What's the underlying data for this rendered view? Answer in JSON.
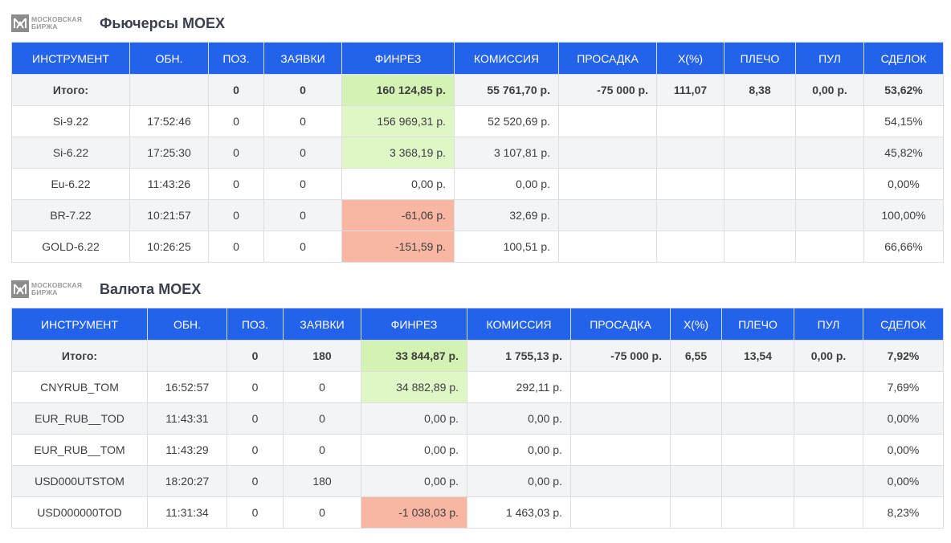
{
  "futures": {
    "logo_line1": "Московская",
    "logo_line2": "Биржа",
    "title": "Фьючерсы MOEX",
    "headers": [
      "ИНСТРУМЕНТ",
      "ОБН.",
      "ПОЗ.",
      "ЗАЯВКИ",
      "ФИНРЕЗ",
      "КОМИССИЯ",
      "ПРОСАДКА",
      "X(%)",
      "ПЛЕЧО",
      "ПУЛ",
      "СДЕЛОК"
    ],
    "total": {
      "instrument": "Итого:",
      "time": "",
      "pos": "0",
      "orders": "0",
      "finres": "160 124,85 р.",
      "commission": "55 761,70 р.",
      "drawdown": "-75 000 р.",
      "x": "111,07",
      "leverage": "8,38",
      "pool": "0,00 р.",
      "deals": "53,62%"
    },
    "rows": [
      {
        "instrument": "Si-9.22",
        "time": "17:52:46",
        "pos": "0",
        "orders": "0",
        "finres": "156 969,31 р.",
        "commission": "52 520,69 р.",
        "drawdown": "",
        "x": "",
        "leverage": "",
        "pool": "",
        "deals": "54,15%"
      },
      {
        "instrument": "Si-6.22",
        "time": "17:25:30",
        "pos": "0",
        "orders": "0",
        "finres": "3 368,19 р.",
        "commission": "3 107,81 р.",
        "drawdown": "",
        "x": "",
        "leverage": "",
        "pool": "",
        "deals": "45,82%"
      },
      {
        "instrument": "Eu-6.22",
        "time": "11:43:26",
        "pos": "0",
        "orders": "0",
        "finres": "0,00 р.",
        "commission": "0,00 р.",
        "drawdown": "",
        "x": "",
        "leverage": "",
        "pool": "",
        "deals": "0,00%"
      },
      {
        "instrument": "BR-7.22",
        "time": "10:21:57",
        "pos": "0",
        "orders": "0",
        "finres": "-61,06 р.",
        "commission": "32,69 р.",
        "drawdown": "",
        "x": "",
        "leverage": "",
        "pool": "",
        "deals": "100,00%"
      },
      {
        "instrument": "GOLD-6.22",
        "time": "10:26:25",
        "pos": "0",
        "orders": "0",
        "finres": "-151,59 р.",
        "commission": "100,51 р.",
        "drawdown": "",
        "x": "",
        "leverage": "",
        "pool": "",
        "deals": "66,66%"
      }
    ]
  },
  "currency": {
    "logo_line1": "Московская",
    "logo_line2": "Биржа",
    "title": "Валюта MOEX",
    "headers": [
      "ИНСТРУМЕНТ",
      "ОБН.",
      "ПОЗ.",
      "ЗАЯВКИ",
      "ФИНРЕЗ",
      "КОМИССИЯ",
      "ПРОСАДКА",
      "X(%)",
      "ПЛЕЧО",
      "ПУЛ",
      "СДЕЛОК"
    ],
    "total": {
      "instrument": "Итого:",
      "time": "",
      "pos": "0",
      "orders": "180",
      "finres": "33 844,87 р.",
      "commission": "1 755,13 р.",
      "drawdown": "-75 000 р.",
      "x": "6,55",
      "leverage": "13,54",
      "pool": "0,00 р.",
      "deals": "7,92%"
    },
    "rows": [
      {
        "instrument": "CNYRUB_TOM",
        "time": "16:52:57",
        "pos": "0",
        "orders": "0",
        "finres": "34 882,89 р.",
        "commission": "292,11 р.",
        "drawdown": "",
        "x": "",
        "leverage": "",
        "pool": "",
        "deals": "7,69%"
      },
      {
        "instrument": "EUR_RUB__TOD",
        "time": "11:43:31",
        "pos": "0",
        "orders": "0",
        "finres": "0,00 р.",
        "commission": "0,00 р.",
        "drawdown": "",
        "x": "",
        "leverage": "",
        "pool": "",
        "deals": "0,00%"
      },
      {
        "instrument": "EUR_RUB__TOM",
        "time": "11:43:29",
        "pos": "0",
        "orders": "0",
        "finres": "0,00 р.",
        "commission": "0,00 р.",
        "drawdown": "",
        "x": "",
        "leverage": "",
        "pool": "",
        "deals": "0,00%"
      },
      {
        "instrument": "USD000UTSTOM",
        "time": "18:20:27",
        "pos": "0",
        "orders": "180",
        "finres": "0,00 р.",
        "commission": "0,00 р.",
        "drawdown": "",
        "x": "",
        "leverage": "",
        "pool": "",
        "deals": "0,00%"
      },
      {
        "instrument": "USD000000TOD",
        "time": "11:31:34",
        "pos": "0",
        "orders": "0",
        "finres": "-1 038,03 р.",
        "commission": "1 463,03 р.",
        "drawdown": "",
        "x": "",
        "leverage": "",
        "pool": "",
        "deals": "8,23%"
      }
    ]
  },
  "colors": {
    "header_bg": "#2362ea",
    "profit_bg": "#dff7c6",
    "loss_bg": "#f9b6a2"
  },
  "icons": {
    "logo": "moex-logo-icon"
  }
}
